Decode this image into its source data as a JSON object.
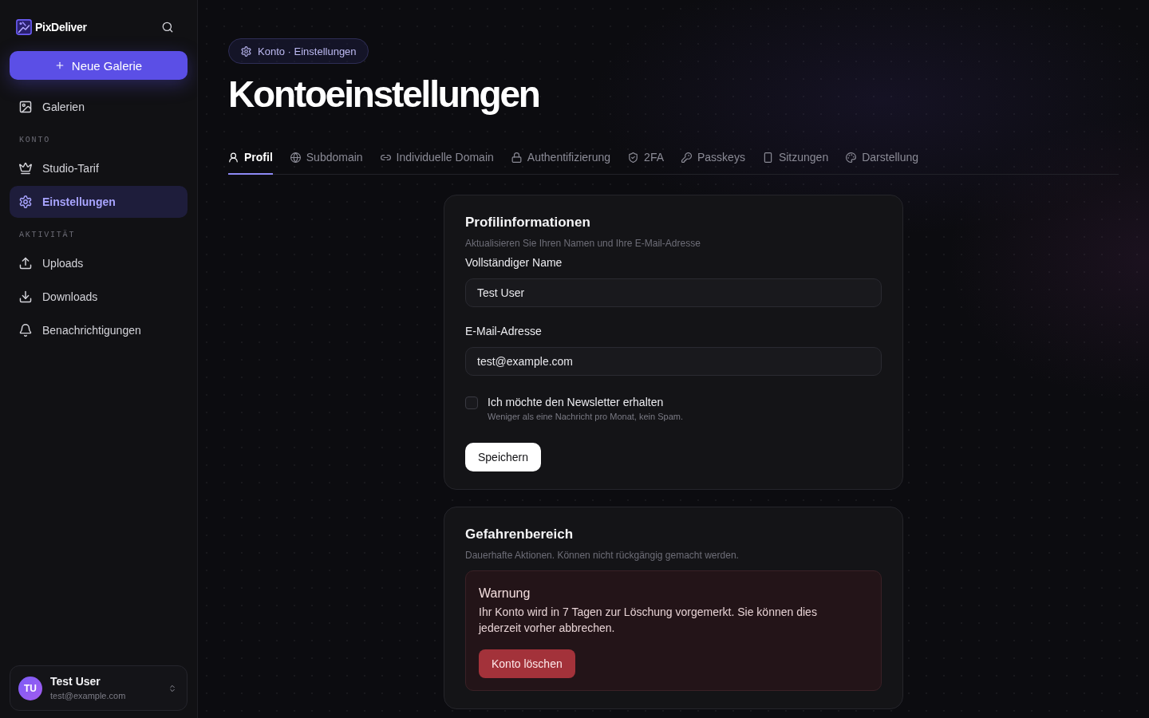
{
  "sidebar": {
    "brand": "PixDeliver",
    "new_gallery_button": "Neue Galerie",
    "sections": [
      {
        "items": [
          {
            "label": "Galerien",
            "selected": false
          }
        ]
      },
      {
        "title": "KONTO",
        "items": [
          {
            "label": "Studio-Tarif",
            "selected": false
          },
          {
            "label": "Einstellungen",
            "selected": true
          }
        ]
      },
      {
        "title": "AKTIVITÄT",
        "items": [
          {
            "label": "Uploads",
            "selected": false
          },
          {
            "label": "Downloads",
            "selected": false
          },
          {
            "label": "Benachrichtigungen",
            "selected": false
          }
        ]
      }
    ],
    "user": {
      "initials": "TU",
      "name": "Test User",
      "email": "test@example.com"
    }
  },
  "breadcrumb": "Konto · Einstellungen",
  "title": "Kontoeinstellungen",
  "tabs": [
    {
      "label": "Profil",
      "selected": true
    },
    {
      "label": "Subdomain",
      "selected": false
    },
    {
      "label": "Individuelle Domain",
      "selected": false
    },
    {
      "label": "Authentifizierung",
      "selected": false
    },
    {
      "label": "2FA",
      "selected": false
    },
    {
      "label": "Passkeys",
      "selected": false
    },
    {
      "label": "Sitzungen",
      "selected": false
    },
    {
      "label": "Darstellung",
      "selected": false
    }
  ],
  "profile_card": {
    "title": "Profilinformationen",
    "subtitle": "Aktualisieren Sie Ihren Namen und Ihre E-Mail-Adresse",
    "fields": [
      {
        "label": "Vollständiger Name",
        "value": "Test User"
      },
      {
        "label": "E-Mail-Adresse",
        "value": "test@example.com"
      }
    ],
    "newsletter": {
      "label": "Ich möchte den Newsletter erhalten",
      "hint": "Weniger als eine Nachricht pro Monat, kein Spam.",
      "checked": false
    },
    "save_button": "Speichern"
  },
  "danger_card": {
    "title": "Gefahrenbereich",
    "subtitle": "Dauerhafte Aktionen. Können nicht rückgängig gemacht werden.",
    "warning": {
      "title": "Warnung",
      "text": "Ihr Konto wird in 7 Tagen zur Löschung vorgemerkt. Sie können dies jederzeit vorher abbrechen.",
      "button": "Konto löschen"
    }
  }
}
